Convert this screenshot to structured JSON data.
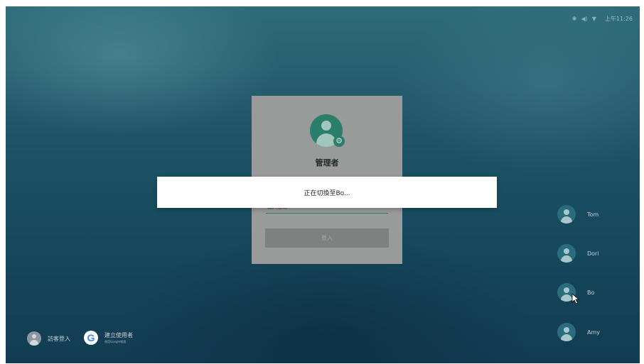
{
  "status_bar": {
    "icons": [
      "bluetooth-icon",
      "volume-icon",
      "wifi-icon"
    ],
    "time": "上午11:26"
  },
  "login_card": {
    "title": "管理者",
    "password_placeholder": "輸入密碼",
    "login_button_label": "登入"
  },
  "toast": {
    "message": "正在切換至Bo..."
  },
  "users": [
    {
      "name": "Tom"
    },
    {
      "name": "Dori"
    },
    {
      "name": "Bo"
    },
    {
      "name": "Amy"
    }
  ],
  "bottom": {
    "guest_label": "訪客登入",
    "create_user_label": "建立使用者",
    "create_user_sub": "使用Google帳號"
  },
  "colors": {
    "accent": "#2a7e6a",
    "card_background": "#999a9a",
    "toast_background": "#ffffff"
  }
}
